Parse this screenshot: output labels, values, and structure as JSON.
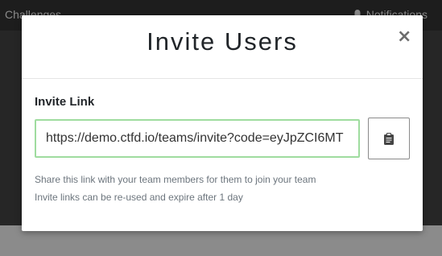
{
  "navbar": {
    "left_label": "Challenges",
    "right_label": "Notifications"
  },
  "modal": {
    "title": "Invite Users",
    "close_symbol": "×",
    "invite_label": "Invite Link",
    "invite_link_value": "https://demo.ctfd.io/teams/invite?code=eyJpZCI6MT",
    "copy_icon": "clipboard-icon",
    "help_lines": [
      "Share this link with your team members for them to join your team",
      "Invite links can be re-used and expire after 1 day"
    ]
  },
  "colors": {
    "input_border": "#9fdc9f",
    "backdrop": "#262626"
  }
}
